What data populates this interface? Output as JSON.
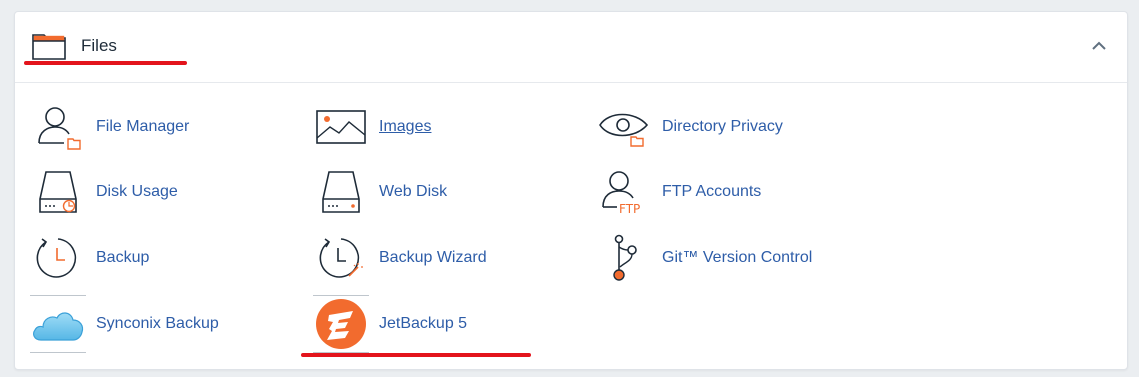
{
  "section": {
    "title": "Files",
    "folder_icon": "folder-icon",
    "collapse_icon": "chevron-up-icon"
  },
  "items": [
    {
      "label": "File Manager",
      "icon": "file-manager-icon"
    },
    {
      "label": "Images",
      "icon": "images-icon"
    },
    {
      "label": "Directory Privacy",
      "icon": "eye-folder-icon"
    },
    {
      "label": "Disk Usage",
      "icon": "disk-usage-icon"
    },
    {
      "label": "Web Disk",
      "icon": "web-disk-icon"
    },
    {
      "label": "FTP Accounts",
      "icon": "ftp-accounts-icon"
    },
    {
      "label": "Backup",
      "icon": "clock-icon"
    },
    {
      "label": "Backup Wizard",
      "icon": "clock-wand-icon"
    },
    {
      "label": "Git™ Version Control",
      "icon": "git-branch-icon"
    },
    {
      "label": "Synconix Backup",
      "icon": "cloud-icon"
    },
    {
      "label": "JetBackup 5",
      "icon": "jetbackup-logo-icon"
    }
  ],
  "colors": {
    "accent": "#f26b2e",
    "link": "#2e5da8",
    "highlight_underline": "#e3141c"
  }
}
